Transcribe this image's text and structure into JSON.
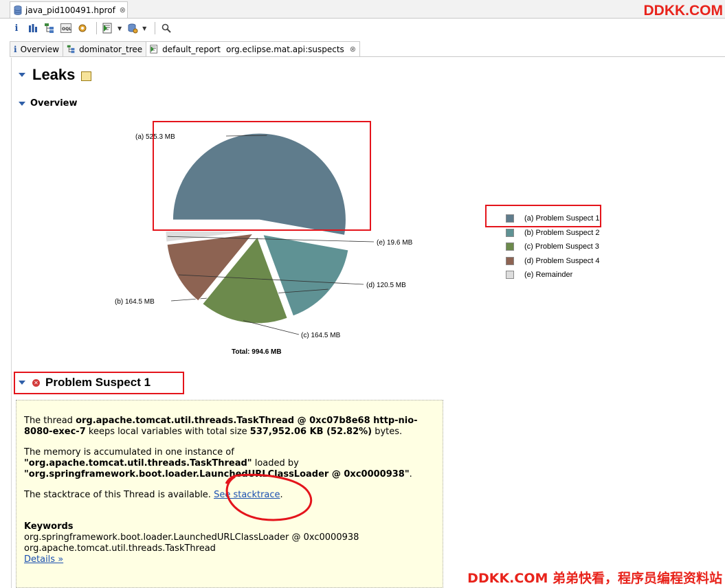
{
  "editor_tab": {
    "label": "java_pid100491.hprof",
    "close": "⊗"
  },
  "watermark_top": "DDKK.COM",
  "watermark_bottom": "DDKK.COM 弟弟快看，程序员编程资料站",
  "toolbar": {
    "icons": [
      "info-icon",
      "histogram-icon",
      "dominator-tree-icon",
      "oql-icon",
      "settings-icon",
      "run-report-icon",
      "query-browser-icon",
      "search-icon"
    ]
  },
  "view_tabs": [
    {
      "icon": "i",
      "label": "Overview"
    },
    {
      "icon": "",
      "label": "dominator_tree"
    },
    {
      "icon": "",
      "label": "default_report",
      "sub": "org.eclipse.mat.api:suspects",
      "close": "⊗"
    }
  ],
  "page": {
    "title": "Leaks",
    "overview_title": "Overview",
    "total_label": "Total: 994.6 MB"
  },
  "chart_data": {
    "type": "pie",
    "title": "",
    "unit": "MB",
    "slices": [
      {
        "key": "(a)",
        "label": "525.3 MB",
        "value": 525.3,
        "legend": "Problem Suspect 1",
        "color": "#5f7c8c"
      },
      {
        "key": "(b)",
        "label": "164.5 MB",
        "value": 164.5,
        "legend": "Problem Suspect 2",
        "color": "#5f9294"
      },
      {
        "key": "(c)",
        "label": "164.5 MB",
        "value": 164.5,
        "legend": "Problem Suspect 3",
        "color": "#6c8a4c"
      },
      {
        "key": "(d)",
        "label": "120.5 MB",
        "value": 120.5,
        "legend": "Problem Suspect 4",
        "color": "#8d6352"
      },
      {
        "key": "(e)",
        "label": "19.6 MB",
        "value": 19.6,
        "legend": "Remainder",
        "color": "#dddddd"
      }
    ],
    "total": 994.6,
    "legend_position": "right"
  },
  "suspect": {
    "title": "Problem Suspect 1",
    "p1_a": "The thread ",
    "p1_b": "org.apache.tomcat.util.threads.TaskThread @ 0xc07b8e68 http-nio-8080-exec-7",
    "p1_c": " keeps local variables with total size ",
    "p1_d": "537,952.06 KB (52.82%)",
    "p1_e": " bytes.",
    "p2_a": "The memory is accumulated in one instance of",
    "p2_b": "\"org.apache.tomcat.util.threads.TaskThread\"",
    "p2_c": " loaded by",
    "p2_d": "\"org.springframework.boot.loader.LaunchedURLClassLoader @ 0xc0000938\"",
    "p2_e": ".",
    "p3_a": "The stacktrace of this Thread is available. ",
    "p3_link": "See stacktrace",
    "p3_b": ".",
    "keywords_title": "Keywords",
    "keywords": [
      "org.springframework.boot.loader.LaunchedURLClassLoader @ 0xc0000938",
      "org.apache.tomcat.util.threads.TaskThread"
    ],
    "details_link": "Details »"
  }
}
